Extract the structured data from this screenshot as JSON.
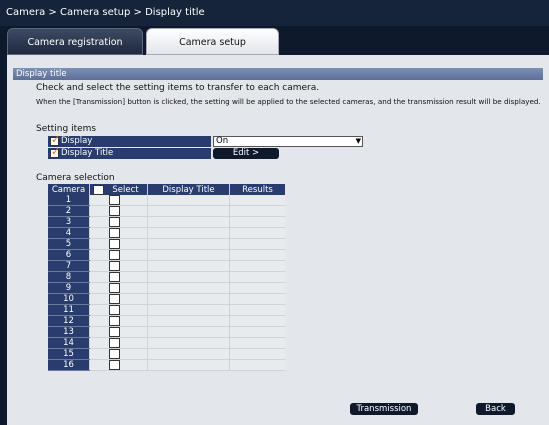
{
  "breadcrumb": "Camera > Camera setup > Display title",
  "tabs": [
    {
      "label": "Camera registration",
      "active": false
    },
    {
      "label": "Camera setup",
      "active": true
    }
  ],
  "section": {
    "title": "Display title",
    "instruction": "Check and select the setting items to transfer to each camera.",
    "note": "When the [Transmission] button is clicked, the setting will be applied to the selected cameras, and the transmission result will be displayed."
  },
  "setting_items": {
    "heading": "Setting items",
    "items": [
      {
        "label": "Display",
        "value": "On",
        "checked": true
      },
      {
        "label": "Display Title",
        "button": "Edit >",
        "checked": true
      }
    ]
  },
  "camera_selection": {
    "heading": "Camera selection",
    "columns": [
      "Camera",
      "Select",
      "Display Title",
      "Results"
    ],
    "rows": [
      "1",
      "2",
      "3",
      "4",
      "5",
      "6",
      "7",
      "8",
      "9",
      "10",
      "11",
      "12",
      "13",
      "14",
      "15",
      "16"
    ]
  },
  "buttons": {
    "transmission": "Transmission",
    "back": "Back"
  },
  "colors": {
    "background": "#0e1a2b",
    "panel": "#e3e6ea",
    "header_blue": "#283c6e",
    "check_accent": "#e07a10"
  }
}
